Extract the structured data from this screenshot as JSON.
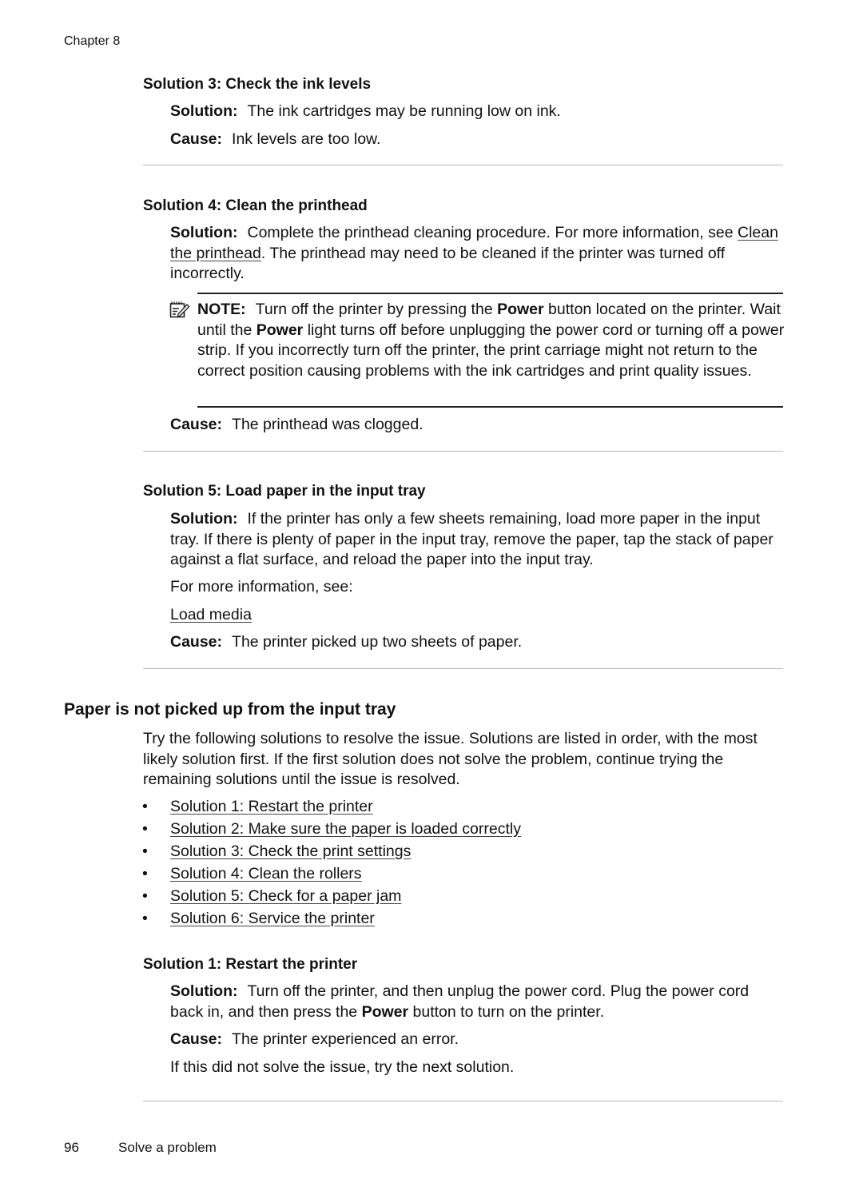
{
  "header": {
    "chapter": "Chapter 8"
  },
  "sections": {
    "s3": {
      "heading": "Solution 3: Check the ink levels",
      "solution_label": "Solution:",
      "solution_text": "The ink cartridges may be running low on ink.",
      "cause_label": "Cause:",
      "cause_text": "Ink levels are too low."
    },
    "s4": {
      "heading": "Solution 4: Clean the printhead",
      "solution_label": "Solution:",
      "solution_text_1": "Complete the printhead cleaning procedure. For more information, see",
      "solution_link": "Clean the printhead",
      "solution_text_2": ". The printhead may need to be cleaned if the printer was turned off incorrectly.",
      "note": {
        "label": "NOTE:",
        "text_1": "Turn off the printer by pressing the",
        "bold_1": "Power",
        "text_2": "button located on the printer. Wait until the",
        "bold_2": "Power",
        "text_3": "light turns off before unplugging the power cord or turning off a power strip. If you incorrectly turn off the printer, the print carriage might not return to the correct position causing problems with the ink cartridges and print quality issues."
      },
      "cause_label": "Cause:",
      "cause_text": "The printhead was clogged."
    },
    "s5": {
      "heading": "Solution 5: Load paper in the input tray",
      "solution_label": "Solution:",
      "solution_text": "If the printer has only a few sheets remaining, load more paper in the input tray. If there is plenty of paper in the input tray, remove the paper, tap the stack of paper against a flat surface, and reload the paper into the input tray.",
      "more_info": "For more information, see:",
      "link": "Load media",
      "cause_label": "Cause:",
      "cause_text": "The printer picked up two sheets of paper."
    }
  },
  "topic": {
    "title": "Paper is not picked up from the input tray",
    "intro": "Try the following solutions to resolve the issue. Solutions are listed in order, with the most likely solution first. If the first solution does not solve the problem, continue trying the remaining solutions until the issue is resolved.",
    "bullet_char": "•",
    "links": [
      "Solution 1: Restart the printer",
      "Solution 2: Make sure the paper is loaded correctly",
      "Solution 3: Check the print settings",
      "Solution 4: Clean the rollers",
      "Solution 5: Check for a paper jam",
      "Solution 6: Service the printer"
    ],
    "s1": {
      "heading": "Solution 1: Restart the printer",
      "solution_label": "Solution:",
      "solution_text_1": "Turn off the printer, and then unplug the power cord. Plug the power cord back in, and then press the",
      "solution_bold": "Power",
      "solution_text_2": "button to turn on the printer.",
      "cause_label": "Cause:",
      "cause_text": "The printer experienced an error.",
      "next": "If this did not solve the issue, try the next solution."
    }
  },
  "footer": {
    "page_number": "96",
    "section_title": "Solve a problem"
  }
}
